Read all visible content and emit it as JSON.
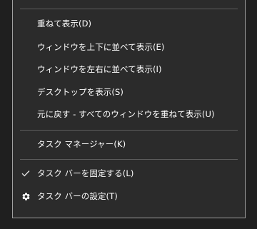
{
  "menu": {
    "items": [
      {
        "label": "重ねて表示(D)"
      },
      {
        "label": "ウィンドウを上下に並べて表示(E)"
      },
      {
        "label": "ウィンドウを左右に並べて表示(I)"
      },
      {
        "label": "デスクトップを表示(S)"
      },
      {
        "label": "元に戻す - すべてのウィンドウを重ねて表示(U)"
      },
      {
        "label": "タスク マネージャー(K)"
      },
      {
        "label": "タスク バーを固定する(L)",
        "icon": "check-icon"
      },
      {
        "label": "タスク バーの設定(T)",
        "icon": "gear-icon"
      }
    ]
  },
  "colors": {
    "menu_bg": "#2b2b2b",
    "text": "#ffffff",
    "separator": "#5c5c5c",
    "border": "#a0a0a0"
  }
}
